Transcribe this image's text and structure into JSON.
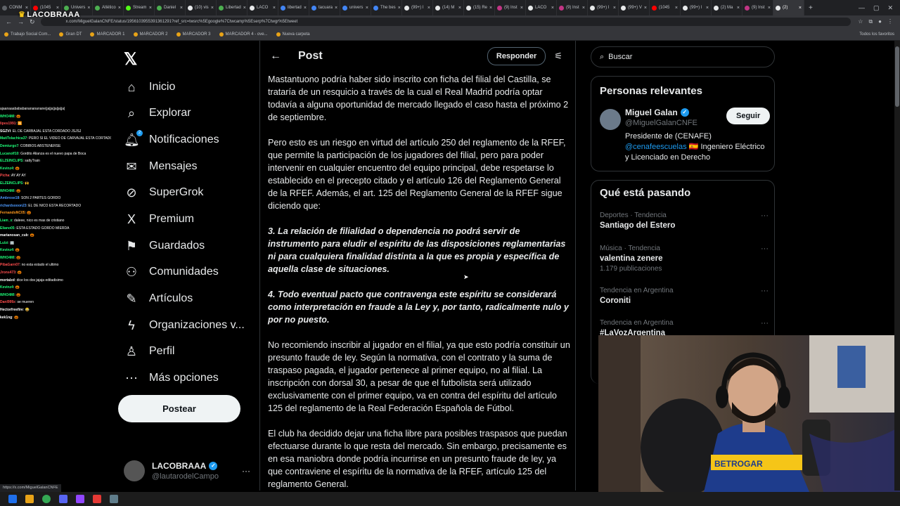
{
  "browser": {
    "tabs": [
      {
        "label": "CONM",
        "color": "#5f6368"
      },
      {
        "label": "(1045",
        "color": "#ff0000"
      },
      {
        "label": "Univers",
        "color": "#4caf50"
      },
      {
        "label": "Atlético",
        "color": "#4caf50"
      },
      {
        "label": "Stream",
        "color": "#53fc18"
      },
      {
        "label": "Daniel",
        "color": "#4caf50"
      },
      {
        "label": "(10) vis",
        "color": "#e7e9ea"
      },
      {
        "label": "Libertad",
        "color": "#4caf50"
      },
      {
        "label": "LACO",
        "color": "#e7e9ea"
      },
      {
        "label": "libertad",
        "color": "#4285f4"
      },
      {
        "label": "tacuara",
        "color": "#4285f4"
      },
      {
        "label": "univers",
        "color": "#4285f4"
      },
      {
        "label": "The bes",
        "color": "#4285f4"
      },
      {
        "label": "(99+) I",
        "color": "#e7e9ea"
      },
      {
        "label": "(14) M",
        "color": "#e7e9ea"
      },
      {
        "label": "(15) Re",
        "color": "#e7e9ea"
      },
      {
        "label": "(9) Inst",
        "color": "#c13584"
      },
      {
        "label": "LACO",
        "color": "#e7e9ea"
      },
      {
        "label": "(9) Inst",
        "color": "#c13584"
      },
      {
        "label": "(99+) I",
        "color": "#e7e9ea"
      },
      {
        "label": "(99+) V",
        "color": "#e7e9ea"
      },
      {
        "label": "(1045",
        "color": "#ff0000"
      },
      {
        "label": "(99+) I",
        "color": "#e7e9ea"
      },
      {
        "label": "(2) Ma",
        "color": "#e7e9ea"
      },
      {
        "label": "(9) Inst",
        "color": "#c13584"
      },
      {
        "label": "(2)",
        "color": "#e7e9ea"
      }
    ],
    "url": "x.com/MiguelGalanCNFE/status/1956103955391361291?ref_src=twsrc%5Egoogle%7Ctwcamp%5Eserp%7Ctwgr%5Etweet",
    "bookmarks": [
      "Trabajo Social Com...",
      "Gran DT",
      "MARCADOR 1",
      "MARCADOR 2",
      "MARCADOR 3",
      "MARCADOR 4 - ove...",
      "Nueva carpeta"
    ],
    "bookmarks_right": "Todos los favoritos",
    "status_url": "https://x.com/MiguelGalanCNFE"
  },
  "overlay_logo": "LACOBRAAA",
  "chat": [
    {
      "user": "",
      "msg": "ajaanaaabababananananane|ja|ja|ja|ja|ja|",
      "color": "#ffffff"
    },
    {
      "user": "WHO4MI",
      "msg": ": 🎃",
      "color": "#1eff7a"
    },
    {
      "user": "lipes1991",
      "msg": ": 🆚",
      "color": "#ff4d4d"
    },
    {
      "user": "SGZVI",
      "msg": ": EL DE CARBAJAL ESTA CORDADO JSJSJ",
      "color": "#ffffff"
    },
    {
      "user": "MatiTolachica37",
      "msg": ": PERO SI EL VIDEO DE CARVAJAL ESTA CORTADO JOJAJAJA COMO NO ROBANDO",
      "color": "#1eff7a"
    },
    {
      "user": "Demiurgo7",
      "msg": ": COBIBOS ABSTENERSE",
      "color": "#1eff7a"
    },
    {
      "user": "Lucanolf10",
      "msg": ": Gordito Alianza es el nuevo papa de Boca",
      "color": "#1eff7a"
    },
    {
      "user": "ELZEINCLIPS",
      "msg": ": saltyTrain",
      "color": "#1eff7a"
    },
    {
      "user": "Kevinz4",
      "msg": ": 🎃",
      "color": "#1eff7a"
    },
    {
      "user": "Picha",
      "msg": ": AY AY AY",
      "color": "#ff4d4d"
    },
    {
      "user": "ELZEINCLIPS",
      "msg": ": 🙌",
      "color": "#1eff7a"
    },
    {
      "user": "WHO4MI",
      "msg": ": 🎃",
      "color": "#1eff7a"
    },
    {
      "user": "Ambrose18",
      "msg": ": SON 2 PARTES GORDO",
      "color": "#4d9aff"
    },
    {
      "user": "richardsooon23",
      "msg": ": EL DE NICO ESTA RECORTADO",
      "color": "#4d9aff"
    },
    {
      "user": "FernandoNC05",
      "msg": ": 🎃",
      "color": "#ff9a1e"
    },
    {
      "user": "Liam_x",
      "msg": ": daleee, nico es mas de cristiano",
      "color": "#1eff7a"
    },
    {
      "user": "Eliano05",
      "msg": ": ESTA ESTADO GORDO MIERDA",
      "color": "#1eff7a"
    },
    {
      "user": "marianosan_cub",
      "msg": ": 🎃",
      "color": "#ffffff"
    },
    {
      "user": "Lulzi",
      "msg": ": 🏢",
      "color": "#1eff7a"
    },
    {
      "user": "Kevinz4",
      "msg": ": 🎃",
      "color": "#1eff7a"
    },
    {
      "user": "WHO4MI",
      "msg": ": 🎃",
      "color": "#1eff7a"
    },
    {
      "user": "PibaGarn07",
      "msg": ": no esta estado el ultimo",
      "color": "#ff4d4d"
    },
    {
      "user": "Jrons473",
      "msg": ": 🎃",
      "color": "#ff4d4d"
    },
    {
      "user": "mortalzd",
      "msg": ": dice los dos jajaja editadisimo",
      "color": "#ffffff"
    },
    {
      "user": "Kevinz4",
      "msg": ": 🎃",
      "color": "#1eff7a"
    },
    {
      "user": "WHO4MI",
      "msg": ": 🎃",
      "color": "#1eff7a"
    },
    {
      "user": "Danl999z",
      "msg": ": se mueren",
      "color": "#ff4d4d"
    },
    {
      "user": "Hectorfreefire",
      "msg": ": 😂",
      "color": "#ffffff"
    },
    {
      "user": "kek1ng",
      "msg": ": 🎃",
      "color": "#ffffff"
    }
  ],
  "nav": {
    "items": [
      {
        "label": "Inicio",
        "icon": "home-icon",
        "glyph": "⌂"
      },
      {
        "label": "Explorar",
        "icon": "search-icon",
        "glyph": "⌕"
      },
      {
        "label": "Notificaciones",
        "icon": "bell-icon",
        "glyph": "🔔︎"
      },
      {
        "label": "Mensajes",
        "icon": "mail-icon",
        "glyph": "✉"
      },
      {
        "label": "SuperGrok",
        "icon": "grok-icon",
        "glyph": "⊘"
      },
      {
        "label": "Premium",
        "icon": "x-premium-icon",
        "glyph": "X"
      },
      {
        "label": "Guardados",
        "icon": "bookmark-icon",
        "glyph": "⚑"
      },
      {
        "label": "Comunidades",
        "icon": "communities-icon",
        "glyph": "⚇"
      },
      {
        "label": "Artículos",
        "icon": "articles-icon",
        "glyph": "✎"
      },
      {
        "label": "Organizaciones v...",
        "icon": "lightning-icon",
        "glyph": "ϟ"
      },
      {
        "label": "Perfil",
        "icon": "person-icon",
        "glyph": "♙"
      },
      {
        "label": "Más opciones",
        "icon": "more-circle-icon",
        "glyph": "⋯"
      }
    ],
    "notifications_badge": "2",
    "post_button": "Postear",
    "account": {
      "name": "LACOBRAAA",
      "handle": "@lautarodelCampo"
    }
  },
  "post": {
    "title": "Post",
    "reply_button": "Responder",
    "paragraphs": [
      {
        "text": "Mastantuono podría haber sido inscrito con ficha del filial del Castilla, se trataría de un resquicio a través de la cual el Real Madrid podría optar todavía a alguna oportunidad de mercado llegado el caso hasta el próximo 2 de septiembre.",
        "emphasis": false
      },
      {
        "text": "Pero esto es un riesgo en virtud del artículo 250 del reglamento de la RFEF, que permite la participación de los jugadores del filial, pero para poder intervenir en cualquier encuentro del equipo principal, debe respetarse lo establecido en el precepto citado y el artículo 126 del Reglamento General de la RFEF. Además, el art. 125 del Reglamento General de la RFEF sigue diciendo que:",
        "emphasis": false
      },
      {
        "text": "3. La relación de filialidad o dependencia no podrá servir de instrumento para eludir el espíritu de las disposiciones reglamentarias ni para cualquiera finalidad distinta a la que es propia y específica de aquella clase de situaciones.",
        "emphasis": true
      },
      {
        "text": "4. Todo eventual pacto que contravenga este espíritu se considerará como interpretación en fraude a la Ley y, por tanto, radicalmente nulo y por no puesto.",
        "emphasis": true
      },
      {
        "text": "No recomiendo inscribir al jugador en el filial, ya que esto podría constituir un presunto fraude de ley. Según la normativa, con el contrato y la suma de traspaso pagada, el jugador pertenece al primer equipo, no al filial. La inscripción con dorsal 30, a pesar de que el futbolista será utilizado exclusivamente con el primer equipo, va en contra del espíritu del artículo 125 del reglamento de la Real Federación Española de Fútbol.",
        "emphasis": false
      },
      {
        "text": "El club ha decidido dejar una ficha libre para posibles traspasos que puedan efectuarse durante lo que resta del mercado. Sin embargo, precisamente es en esa maniobra donde podría incurrirse en un presunto fraude de ley, ya que contraviene el espíritu de la normativa de la RFEF, artículo 125 del reglamento General.",
        "emphasis": false
      }
    ]
  },
  "sidebar": {
    "search_placeholder": "Buscar",
    "relevant_title": "Personas relevantes",
    "person": {
      "name": "Miguel Galan",
      "handle": "@MiguelGalanCNFE",
      "follow": "Seguir",
      "bio_prefix": "Presidente de (CENAFE)",
      "bio_link": "@cenafeescuelas",
      "bio_flag": "🇪🇸",
      "bio_suffix": "Ingeniero Eléctrico y Licenciado en Derecho"
    },
    "trending_title": "Qué está pasando",
    "trends": [
      {
        "meta": "Deportes · Tendencia",
        "name": "Santiago del Estero",
        "posts": ""
      },
      {
        "meta": "Música · Tendencia",
        "name": "valentina zenere",
        "posts": "1.179 publicaciones"
      },
      {
        "meta": "Tendencia en Argentina",
        "name": "Coroniti",
        "posts": ""
      },
      {
        "meta": "Tendencia en Argentina",
        "name": "#LaVozArgentina",
        "posts": ""
      }
    ]
  },
  "webcam": {
    "shirt_text": "BETROGAR"
  },
  "colors": {
    "accent": "#1d9bf0",
    "background": "#000000",
    "border": "#2f3336",
    "muted": "#71767b"
  }
}
